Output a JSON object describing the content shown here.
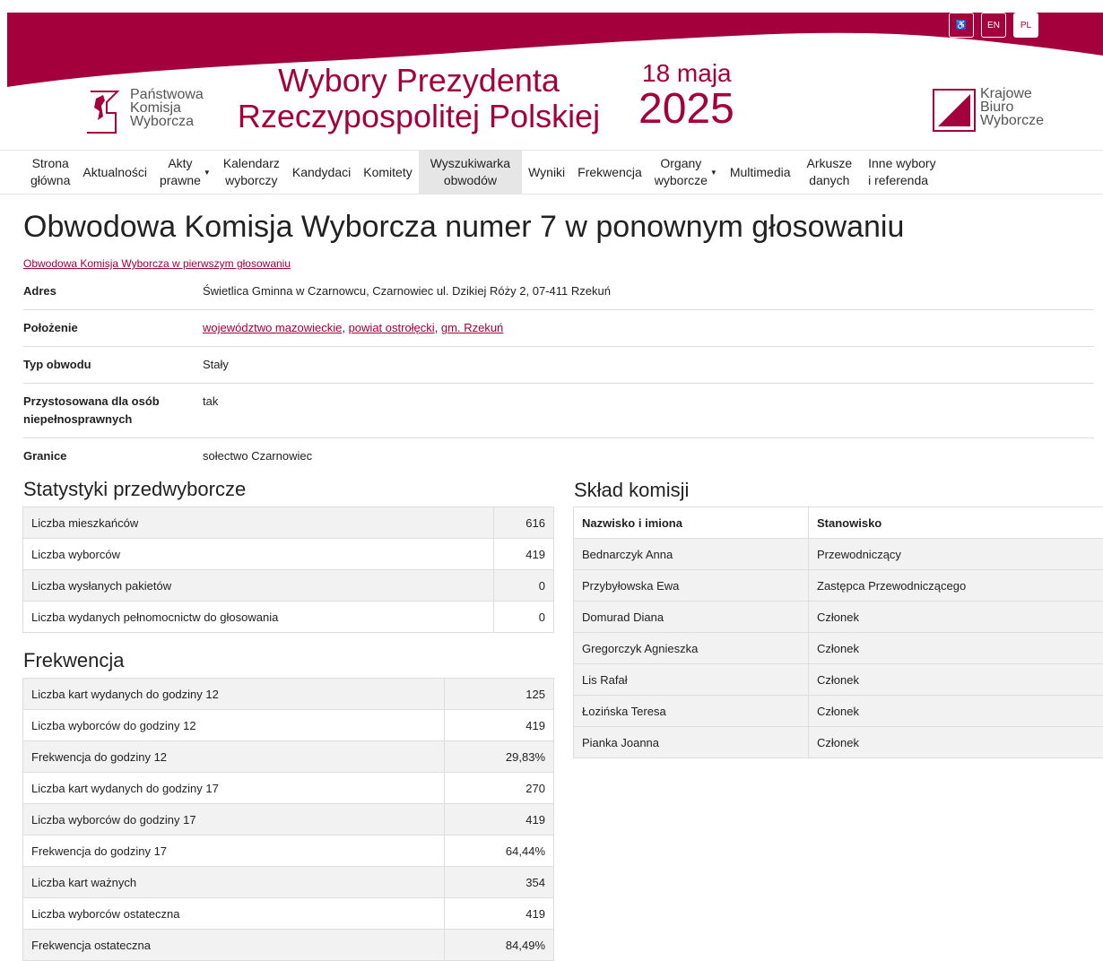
{
  "header": {
    "accessibility_label": "♿",
    "lang_en": "EN",
    "lang_pl": "PL",
    "pkw_lines": [
      "Państwowa",
      "Komisja",
      "Wyborcza"
    ],
    "title_line1": "Wybory Prezydenta",
    "title_line2": "Rzeczypospolitej Polskiej",
    "date_day": "18 maja",
    "date_year": "2025",
    "kbw_lines": [
      "Krajowe",
      "Biuro",
      "Wyborcze"
    ],
    "brand_color": "#a4003b"
  },
  "nav": [
    {
      "line1": "Strona",
      "line2": "główna"
    },
    {
      "line1": "Aktualności",
      "line2": ""
    },
    {
      "line1": "Akty",
      "line2": "prawne",
      "dropdown": true
    },
    {
      "line1": "Kalendarz",
      "line2": "wyborczy"
    },
    {
      "line1": "Kandydaci",
      "line2": ""
    },
    {
      "line1": "Komitety",
      "line2": ""
    },
    {
      "line1": "Wyszukiwarka",
      "line2": "obwodów",
      "active": true
    },
    {
      "line1": "Wyniki",
      "line2": ""
    },
    {
      "line1": "Frekwencja",
      "line2": ""
    },
    {
      "line1": "Organy",
      "line2": "wyborcze",
      "dropdown": true
    },
    {
      "line1": "Multimedia",
      "line2": ""
    },
    {
      "line1": "Arkusze",
      "line2": "danych"
    },
    {
      "line1": "Inne wybory",
      "line2": "i referenda"
    }
  ],
  "page": {
    "title": "Obwodowa Komisja Wyborcza numer 7 w ponownym głosowaniu",
    "first_round_link": "Obwodowa Komisja Wyborcza w pierwszym głosowaniu"
  },
  "info": {
    "address_label": "Adres",
    "address_value": "Świetlica Gminna w Czarnowcu, Czarnowiec ul. Dzikiej Róży 2, 07-411 Rzekuń",
    "location_label": "Położenie",
    "location_links": [
      "województwo mazowieckie",
      "powiat ostrołęcki",
      "gm. Rzekuń"
    ],
    "type_label": "Typ obwodu",
    "type_value": "Stały",
    "access_label_1": "Przystosowana dla osób",
    "access_label_2": "niepełnosprawnych",
    "access_value": "tak",
    "borders_label": "Granice",
    "borders_value": "sołectwo Czarnowiec"
  },
  "stats": {
    "heading": "Statystyki przedwyborcze",
    "rows": [
      {
        "label": "Liczba mieszkańców",
        "value": "616"
      },
      {
        "label": "Liczba wyborców",
        "value": "419"
      },
      {
        "label": "Liczba wysłanych pakietów",
        "value": "0"
      },
      {
        "label": "Liczba wydanych pełnomocnictw do głosowania",
        "value": "0"
      }
    ]
  },
  "turnout": {
    "heading": "Frekwencja",
    "rows": [
      {
        "label": "Liczba kart wydanych do godziny 12",
        "value": "125"
      },
      {
        "label": "Liczba wyborców do godziny 12",
        "value": "419"
      },
      {
        "label": "Frekwencja do godziny 12",
        "value": "29,83%"
      },
      {
        "label": "Liczba kart wydanych do godziny 17",
        "value": "270"
      },
      {
        "label": "Liczba wyborców do godziny 17",
        "value": "419"
      },
      {
        "label": "Frekwencja do godziny 17",
        "value": "64,44%"
      },
      {
        "label": "Liczba kart ważnych",
        "value": "354"
      },
      {
        "label": "Liczba wyborców ostateczna",
        "value": "419"
      },
      {
        "label": "Frekwencja ostateczna",
        "value": "84,49%"
      }
    ]
  },
  "committee": {
    "heading": "Skład komisji",
    "col_name": "Nazwisko i imiona",
    "col_role": "Stanowisko",
    "rows": [
      {
        "name": "Bednarczyk Anna",
        "role": "Przewodniczący"
      },
      {
        "name": "Przybyłowska Ewa",
        "role": "Zastępca Przewodniczącego"
      },
      {
        "name": "Domurad Diana",
        "role": "Członek"
      },
      {
        "name": "Gregorczyk Agnieszka",
        "role": "Członek"
      },
      {
        "name": "Lis Rafał",
        "role": "Członek"
      },
      {
        "name": "Łozińska Teresa",
        "role": "Członek"
      },
      {
        "name": "Pianka Joanna",
        "role": "Członek"
      }
    ]
  }
}
